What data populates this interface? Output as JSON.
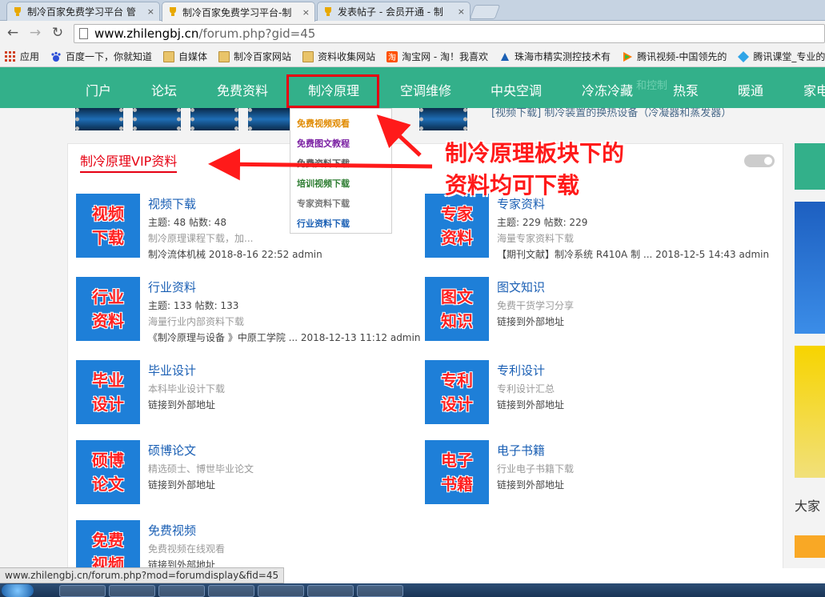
{
  "tabs": [
    {
      "label": "制冷百家免费学习平台 管",
      "active": false
    },
    {
      "label": "制冷百家免费学习平台-制",
      "active": true
    },
    {
      "label": "发表帖子 - 会员开通 - 制",
      "active": false
    }
  ],
  "tab_close_glyph": "×",
  "address": {
    "host": "www.zhilengbj.cn",
    "path": "/forum.php?gid=45"
  },
  "bookmarks": [
    {
      "label": "应用",
      "icon": "apps-icon"
    },
    {
      "label": "百度一下，你就知道",
      "icon": "baidu-icon"
    },
    {
      "label": "自媒体",
      "icon": "folder-icon"
    },
    {
      "label": "制冷百家网站",
      "icon": "folder-icon"
    },
    {
      "label": "资料收集网站",
      "icon": "folder-icon"
    },
    {
      "label": "淘宝网 - 淘！我喜欢",
      "icon": "taobao-icon"
    },
    {
      "label": "珠海市精实测控技术有",
      "icon": "site-icon"
    },
    {
      "label": "腾讯视频-中国领先的",
      "icon": "tencent-video-icon"
    },
    {
      "label": "腾讯课堂_专业的",
      "icon": "tencent-classroom-icon"
    }
  ],
  "nav": [
    "门户",
    "论坛",
    "免费资料",
    "制冷原理",
    "空调维修",
    "中央空调",
    "冷冻冷藏",
    "热泵",
    "暖通",
    "家电"
  ],
  "faded": {
    "text1": "[视频下载]  制冷装置的换热设备（冷凝器和蒸发器）",
    "text2": "和控制"
  },
  "dropdown": [
    {
      "label": "免费视频观看",
      "color": "#e08a00"
    },
    {
      "label": "免费图文教程",
      "color": "#7a1fa2"
    },
    {
      "label": "免费资料下载",
      "color": "#555555"
    },
    {
      "label": "培训视频下载",
      "color": "#2e7d32"
    },
    {
      "label": "专家资料下载",
      "color": "#777777"
    },
    {
      "label": "行业资料下载",
      "color": "#1a5fb4"
    }
  ],
  "section_title": "制冷原理VIP资料",
  "annotation": {
    "line1": "制冷原理板块下的",
    "line2": "资料均可下载",
    "color": "#ff1a1a"
  },
  "forums": [
    {
      "icon1": "视频",
      "icon2": "下载",
      "title": "视频下载",
      "stats": "主题: 48 帖数: 48",
      "desc": "制冷原理课程下载，加...",
      "last": "制冷流体机械 2018-8-16 22:52 admin"
    },
    {
      "icon1": "专家",
      "icon2": "资料",
      "title": "专家资料",
      "stats": "主题: 229 帖数: 229",
      "desc": "海量专家资料下载",
      "last": "【期刊文献】制冷系统 R410A 制 ... 2018-12-5 14:43 admin"
    },
    {
      "icon1": "行业",
      "icon2": "资料",
      "title": "行业资料",
      "stats": "主题: 133 帖数: 133",
      "desc": "海量行业内部资料下载",
      "last": "《制冷原理与设备 》中原工学院 ... 2018-12-13 11:12 admin"
    },
    {
      "icon1": "图文",
      "icon2": "知识",
      "title": "图文知识",
      "stats": "",
      "desc": "免费干货学习分享",
      "last": "链接到外部地址"
    },
    {
      "icon1": "毕业",
      "icon2": "设计",
      "title": "毕业设计",
      "stats": "",
      "desc": "本科毕业设计下载",
      "last": "链接到外部地址"
    },
    {
      "icon1": "专利",
      "icon2": "设计",
      "title": "专利设计",
      "stats": "",
      "desc": "专利设计汇总",
      "last": "链接到外部地址"
    },
    {
      "icon1": "硕博",
      "icon2": "论文",
      "title": "硕博论文",
      "stats": "",
      "desc": "精选硕士、博世毕业论文",
      "last": "链接到外部地址"
    },
    {
      "icon1": "电子",
      "icon2": "书籍",
      "title": "电子书籍",
      "stats": "",
      "desc": "行业电子书籍下载",
      "last": "链接到外部地址"
    },
    {
      "icon1": "免费",
      "icon2": "视频",
      "title": "免费视频",
      "stats": "",
      "desc": "免费视频在线观看",
      "last": "链接到外部地址"
    }
  ],
  "sidebar": {
    "heading": "大家"
  },
  "status_url": "www.zhilengbj.cn/forum.php?mod=forumdisplay&fid=45",
  "colors": {
    "nav": "#33b08a",
    "accent": "#e60012",
    "card": "#1e7fd8"
  }
}
